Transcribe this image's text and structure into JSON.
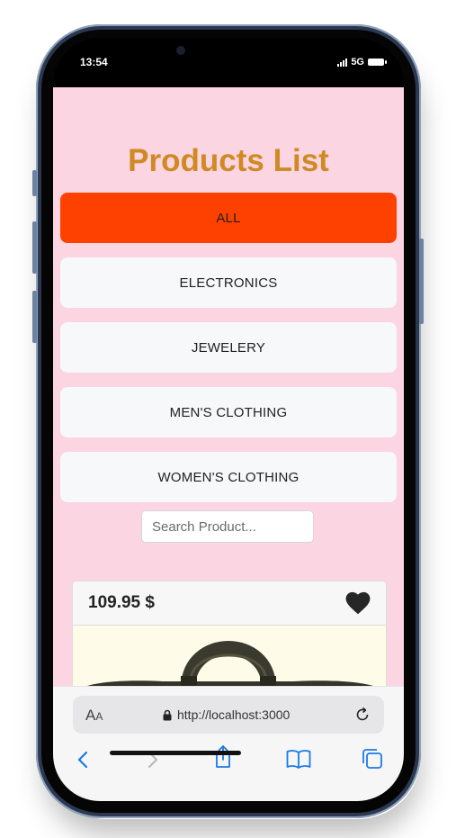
{
  "status_bar": {
    "time": "13:54",
    "network": "5G"
  },
  "page": {
    "title": "Products List"
  },
  "categories": [
    {
      "label": "ALL",
      "active": true
    },
    {
      "label": "ELECTRONICS",
      "active": false
    },
    {
      "label": "JEWELERY",
      "active": false
    },
    {
      "label": "MEN'S CLOTHING",
      "active": false
    },
    {
      "label": "WOMEN'S CLOTHING",
      "active": false
    }
  ],
  "search": {
    "placeholder": "Search Product...",
    "value": ""
  },
  "products": [
    {
      "price": "109.95 $",
      "favorite": true
    }
  ],
  "browser": {
    "text_size_label_big": "A",
    "text_size_label_small": "A",
    "url": "http://localhost:3000",
    "toolbar": [
      "back-icon",
      "forward-icon",
      "share-icon",
      "bookmarks-icon",
      "tabs-icon"
    ]
  },
  "colors": {
    "page_background": "#fbd5e1",
    "title": "#cf8a24",
    "active_category": "#ff4100",
    "category_button": "#f7f8fa",
    "browser_accent": "#1a7ae6"
  }
}
